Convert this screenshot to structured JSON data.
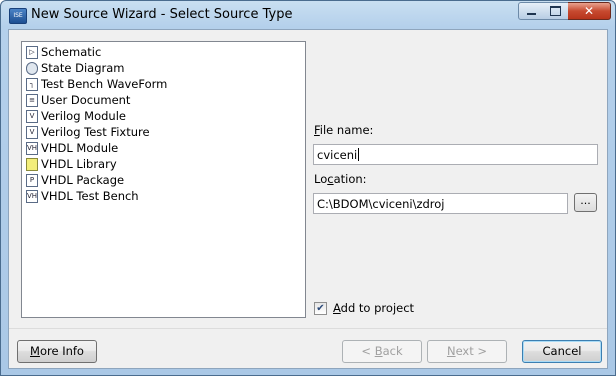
{
  "window": {
    "title": "New Source Wizard - Select Source Type",
    "icon_text": "ISE"
  },
  "source_types": [
    {
      "label": "Schematic",
      "icon": "schematic-icon",
      "icon_text": "▷"
    },
    {
      "label": "State Diagram",
      "icon": "state-diagram-icon",
      "icon_text": ""
    },
    {
      "label": "Test Bench WaveForm",
      "icon": "waveform-icon",
      "icon_text": "┐"
    },
    {
      "label": "User Document",
      "icon": "document-icon",
      "icon_text": "≡"
    },
    {
      "label": "Verilog Module",
      "icon": "verilog-module-icon",
      "icon_text": "V"
    },
    {
      "label": "Verilog Test Fixture",
      "icon": "verilog-fixture-icon",
      "icon_text": "V"
    },
    {
      "label": "VHDL Module",
      "icon": "vhdl-module-icon",
      "icon_text": "VH"
    },
    {
      "label": "VHDL Library",
      "icon": "vhdl-library-icon",
      "icon_text": ""
    },
    {
      "label": "VHDL Package",
      "icon": "vhdl-package-icon",
      "icon_text": "P"
    },
    {
      "label": "VHDL Test Bench",
      "icon": "vhdl-testbench-icon",
      "icon_text": "VH"
    }
  ],
  "file_name": {
    "label_first": "F",
    "label_rest": "ile name:",
    "value": "cviceni"
  },
  "location": {
    "label_first": "Lo",
    "label_u": "c",
    "label_rest": "ation:",
    "value": "C:\\BDOM\\cviceni\\zdroj",
    "browse_label": "..."
  },
  "add_to_project": {
    "label_first": "A",
    "label_rest": "dd to project",
    "checked": true,
    "check_glyph": "✔"
  },
  "buttons": {
    "more_info": {
      "u": "M",
      "rest": "ore Info"
    },
    "back": {
      "pre": "< ",
      "u": "B",
      "rest": "ack"
    },
    "next": {
      "u": "N",
      "rest": "ext >"
    },
    "cancel": "Cancel"
  }
}
